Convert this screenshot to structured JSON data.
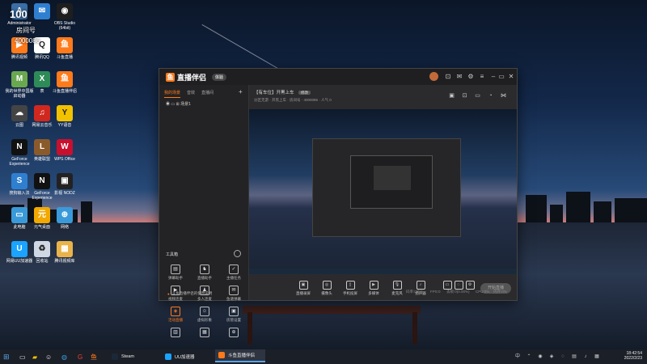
{
  "desktop": {
    "overlay": {
      "line1": "100",
      "line2": "房间号",
      "line3": "4000086"
    },
    "icons": [
      {
        "label": "Administrator",
        "color": "#3a6ea5",
        "glyph": "A"
      },
      {
        "label": "",
        "color": "#2f7fd1",
        "glyph": "✉"
      },
      {
        "label": "OBS Studio (64bit)",
        "color": "#1e1e1e",
        "glyph": "◉"
      },
      {
        "label": "腾讯视频",
        "color": "#ff7a1a",
        "glyph": "▶"
      },
      {
        "label": "腾讯QQ",
        "color": "#ffffff",
        "glyph": "Q"
      },
      {
        "label": "斗鱼直播",
        "color": "#ff7a1a",
        "glyph": "鱼"
      },
      {
        "label": "我的世界中国版启动器",
        "color": "#6aa84f",
        "glyph": "M"
      },
      {
        "label": "表",
        "color": "#2e8b57",
        "glyph": "X"
      },
      {
        "label": "斗鱼直播伴侣",
        "color": "#ff7a1a",
        "glyph": "鱼"
      },
      {
        "label": "云图",
        "color": "#444",
        "glyph": "☁"
      },
      {
        "label": "网易云音乐",
        "color": "#d0281e",
        "glyph": "♫"
      },
      {
        "label": "YY语音",
        "color": "#f2c200",
        "glyph": "Y"
      },
      {
        "label": "GeForce Experience",
        "color": "#111",
        "glyph": "N"
      },
      {
        "label": "英雄联盟",
        "color": "#8a5a2b",
        "glyph": "L"
      },
      {
        "label": "WPS Office",
        "color": "#c8102e",
        "glyph": "W"
      },
      {
        "label": "搜狗输入法",
        "color": "#2f7fd1",
        "glyph": "S"
      },
      {
        "label": "GeForce Experience",
        "color": "#111",
        "glyph": "N"
      },
      {
        "label": "影视 NODZ",
        "color": "#222",
        "glyph": "▣"
      },
      {
        "label": "此电脑",
        "color": "#3a9ad9",
        "glyph": "▭"
      },
      {
        "label": "元气桌面",
        "color": "#f2a900",
        "glyph": "元"
      },
      {
        "label": "网络",
        "color": "#3a9ad9",
        "glyph": "⊕"
      },
      {
        "label": "网易UU加速器",
        "color": "#1aa3ff",
        "glyph": "U"
      },
      {
        "label": "回收站",
        "color": "#cfd8e3",
        "glyph": "♻"
      },
      {
        "label": "腾讯视频库",
        "color": "#e8b34a",
        "glyph": "▦"
      }
    ]
  },
  "app": {
    "name": "直播伴侣",
    "version": "体验",
    "left_tabs": [
      "我的场景",
      "音效",
      "直播间"
    ],
    "scene": "场景1",
    "tools_title": "工具箱",
    "tools": [
      {
        "label": "弹幕助手",
        "glyph": "▤",
        "hot": false
      },
      {
        "label": "直播助手",
        "glyph": "♞",
        "hot": false
      },
      {
        "label": "主播任务",
        "glyph": "✓",
        "hot": false
      },
      {
        "label": "视频连麦",
        "glyph": "▶",
        "hot": false
      },
      {
        "label": "多人连麦",
        "glyph": "♟",
        "hot": false
      },
      {
        "label": "鱼塘弹幕",
        "glyph": "✉",
        "hot": false
      },
      {
        "label": "活动直播",
        "glyph": "◈",
        "hot": true
      },
      {
        "label": "虚拟形象",
        "glyph": "☺",
        "hot": false
      },
      {
        "label": "房管设置",
        "glyph": "▣",
        "hot": false
      },
      {
        "label": "",
        "glyph": "▥",
        "hot": false
      },
      {
        "label": "",
        "glyph": "▦",
        "hot": false
      },
      {
        "label": "",
        "glyph": "⊕",
        "hot": false
      }
    ],
    "notice": "斗鱼直播伴侣的使用说明",
    "stream_title": "【有车位】开黑上车",
    "edit_label": "修改",
    "sub_info": "分区无游 · 开黑上车 · 房间号 · 4000086 · 人气 0",
    "bottom_tools": [
      "直播录屏",
      "摄像头",
      "手机投屏",
      "多媒体",
      "麦克风",
      "扬声器"
    ],
    "go_live": "开始直播",
    "stats": [
      "码率:0kb/s",
      "FPS:0",
      "丢帧:0(0.00%)",
      "CPU:0%",
      "内存:0%"
    ]
  },
  "taskbar": {
    "items": [
      {
        "label": "Steam",
        "color": "#1b2838",
        "active": false
      },
      {
        "label": "UU加速器",
        "color": "#1aa3ff",
        "active": false
      },
      {
        "label": "斗鱼直播伴侣",
        "color": "#ff7a1a",
        "active": true
      }
    ],
    "time": "18:42:54",
    "date": "2022/2/23",
    "tray_lang": "中"
  }
}
